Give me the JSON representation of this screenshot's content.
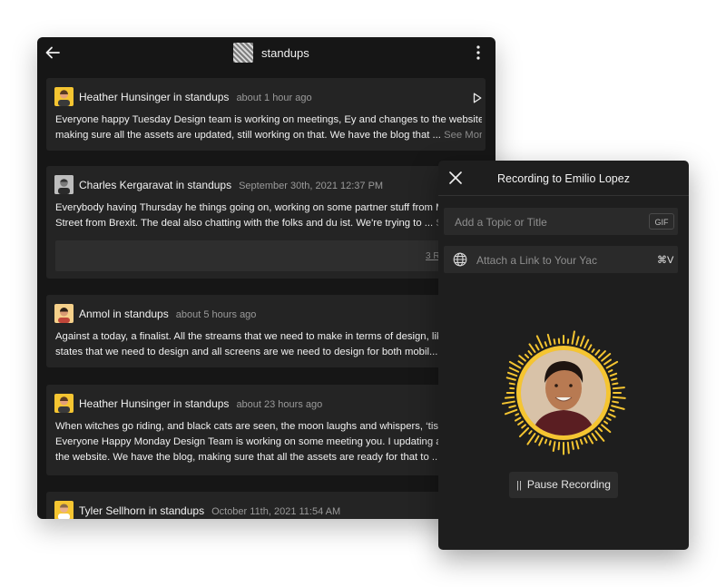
{
  "feed": {
    "channel_name": "standups",
    "posts": [
      {
        "author": "Heather Hunsinger in standups",
        "time": "about 1 hour ago",
        "lines": [
          "Everyone happy Tuesday Design team is working on meetings, Ey and changes to the website,",
          "making sure all the assets are updated, still working on that. We have the blog that ..."
        ],
        "see_more": "See More"
      },
      {
        "author": "Charles Kergaravat in standups",
        "time": "September 30th, 2021 12:37 PM",
        "lines": [
          "Everybody having Thursday he things going on, working on some partner stuff from Ma",
          "Street from Brexit. The deal also chatting with the folks and du ist. We're trying to ..."
        ],
        "see_more": "Se",
        "reply_count": "3 Rep"
      },
      {
        "author": "Anmol in standups",
        "time": "about 5 hours ago",
        "lines": [
          "Against a today, a finalist. All the streams that we need to make in terms of design, like",
          "states that we need to design and all screens are we need to design for both mobil..."
        ],
        "see_more": "S"
      },
      {
        "author": "Heather Hunsinger in standups",
        "time": "about 23 hours ago",
        "lines": [
          "When witches go riding, and black cats are seen, the moon laughs and whispers, ‘tis ne",
          "Everyone Happy Monday Design Team is working on some meeting you. I updating asse",
          "the website. We have the blog, making sure that all the assets are ready for that to ..."
        ],
        "see_more": "S"
      },
      {
        "author": "Tyler Sellhorn in standups",
        "time": "October 11th, 2021 11:54 AM"
      }
    ]
  },
  "recording": {
    "title": "Recording to Emilio Lopez",
    "topic_placeholder": "Add a Topic or Title",
    "gif_label": "GIF",
    "link_placeholder": "Attach a Link to Your Yac",
    "link_shortcut": "⌘V",
    "pause_label": "Pause Recording"
  },
  "colors": {
    "accent_yellow": "#f5c531",
    "window_bg": "#161616",
    "card_bg": "#242424",
    "panel_bg": "#1e1e1e"
  },
  "icons": [
    "back-arrow-icon",
    "kebab-menu-icon",
    "play-icon",
    "close-icon",
    "globe-icon",
    "pause-icon"
  ]
}
